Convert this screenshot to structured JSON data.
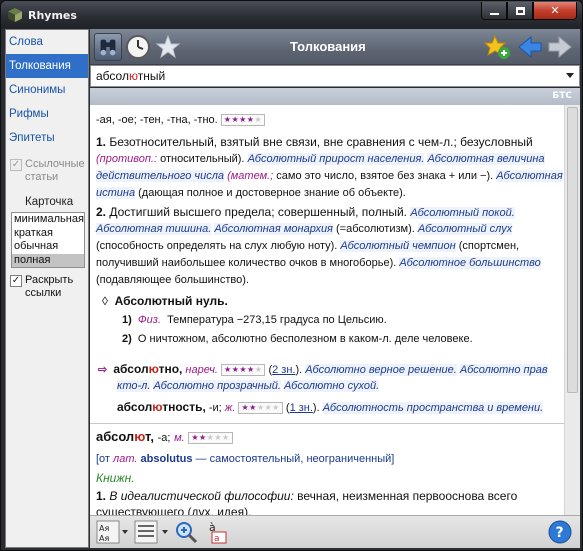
{
  "app": {
    "title": "Rhymes"
  },
  "sidebar": {
    "items": [
      {
        "label": "Слова"
      },
      {
        "label": "Толкования"
      },
      {
        "label": "Синонимы"
      },
      {
        "label": "Рифмы"
      },
      {
        "label": "Эпитеты"
      }
    ],
    "refs_checkbox": {
      "label_1": "Ссылочные",
      "label_2": "статьи"
    },
    "card_label": "Карточка",
    "card_options": [
      "минимальная",
      "краткая",
      "обычная",
      "полная"
    ],
    "card_selected": "полная",
    "expand_checkbox": {
      "label_1": "Раскрыть",
      "label_2": "ссылки"
    }
  },
  "toolbar": {
    "title": "Толкования"
  },
  "search": {
    "word_pre": "абсол",
    "word_hl": "ю",
    "word_post": "тный"
  },
  "source": "БТС",
  "entry1": {
    "l1": "-ая, -ое; -тен, -тна, -тно.",
    "l2_num": "1.",
    "l2": "Безотносительный, взятый вне связи, вне сравнения с чем-л.; безусловный",
    "l3_note": "(противоп.:",
    "l3_a": "относительный).",
    "l3_ex1": "Абсолютный прирост населения.",
    "l3_ex2": "Абсолютная величина",
    "l4_ex": "действительного числа",
    "l4_note": "(матем.;",
    "l4_b": "само это число, взятое без знака + или −).",
    "l4_ex2": "Абсолютная",
    "l5_ex": "истина",
    "l5_b": "(дающая полное и достоверное знание об объекте).",
    "l6_num": "2.",
    "l6": "Достигший высшего предела; совершенный, полный.",
    "l6_ex": "Абсолютный покой.",
    "l7_ex": "Абсолютная тишина.",
    "l7_ex2": "Абсолютная монархия",
    "l7_b": "(=абсолютизм).",
    "l7_ex3": "Абсолютный слух",
    "l8_b": "(способность определять на слух любую ноту).",
    "l8_ex": "Абсолютный чемпион",
    "l8_c": "(спортсмен,",
    "l9_b": "получивший наибольшее количество очков в многоборье).",
    "l9_ex": "Абсолютное большинство",
    "l10": "(подавляющее большинство).",
    "idiom_mark": "◊",
    "idiom": "Абсолютный нуль.",
    "i1_num": "1)",
    "i1_note": "Физ.",
    "i1": "Температура −273,15 градуса по Цельсию.",
    "i2_num": "2)",
    "i2": "О ничтожном, абсолютно бесполезном в каком-л. деле человеке.",
    "d1_word_pre": "абсол",
    "d1_word_hl": "ю",
    "d1_word_post": "тно,",
    "d1_pos": "нареч.",
    "d1_link": "2 зн.",
    "d1_ex": "Абсолютно верное решение.",
    "d1_ex2": "Абсолютно прав",
    "d2_ex": "кто-л.",
    "d2_ex2": "Абсолютно прозрачный.",
    "d2_ex3": "Абсолютно сухой.",
    "d3_word_pre": "абсол",
    "d3_word_hl": "ю",
    "d3_word_post": "тность,",
    "d3_b": "-и;",
    "d3_pos": "ж.",
    "d3_link": "1 зн.",
    "d3_ex": "Абсолютность пространства и времени."
  },
  "entry2": {
    "head_pre": "абсол",
    "head_hl": "ю",
    "head_post": "т,",
    "head_b": "-а;",
    "head_pos": "м.",
    "etym_a": "[от",
    "etym_note": "лат.",
    "etym_w": "absolutus",
    "etym_b": "— самостоятельный, неограниченный]",
    "style": "Книжн.",
    "l1_num": "1.",
    "l1_ex": "В идеалистической философии:",
    "l1": "вечная, неизменная первооснова всего",
    "l2": "существующего (дух, идея)."
  },
  "colors": {
    "accent": "#2f6fc8",
    "toolbar": "#6a7381",
    "close": "#c4402d"
  }
}
